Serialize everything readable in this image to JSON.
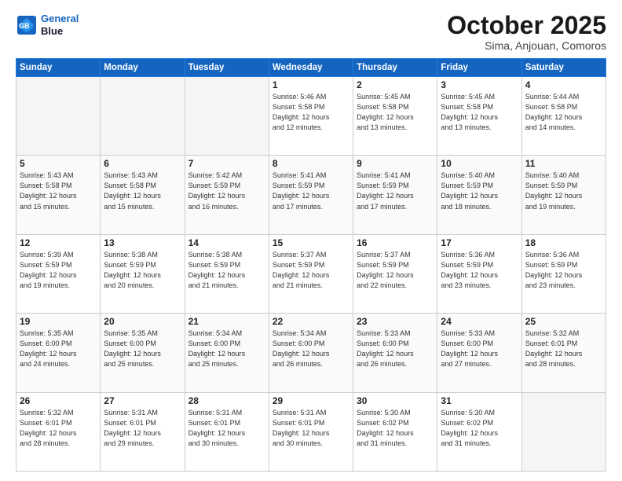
{
  "logo": {
    "line1": "General",
    "line2": "Blue"
  },
  "title": "October 2025",
  "location": "Sima, Anjouan, Comoros",
  "days_header": [
    "Sunday",
    "Monday",
    "Tuesday",
    "Wednesday",
    "Thursday",
    "Friday",
    "Saturday"
  ],
  "weeks": [
    [
      {
        "num": "",
        "info": ""
      },
      {
        "num": "",
        "info": ""
      },
      {
        "num": "",
        "info": ""
      },
      {
        "num": "1",
        "info": "Sunrise: 5:46 AM\nSunset: 5:58 PM\nDaylight: 12 hours\nand 12 minutes."
      },
      {
        "num": "2",
        "info": "Sunrise: 5:45 AM\nSunset: 5:58 PM\nDaylight: 12 hours\nand 13 minutes."
      },
      {
        "num": "3",
        "info": "Sunrise: 5:45 AM\nSunset: 5:58 PM\nDaylight: 12 hours\nand 13 minutes."
      },
      {
        "num": "4",
        "info": "Sunrise: 5:44 AM\nSunset: 5:58 PM\nDaylight: 12 hours\nand 14 minutes."
      }
    ],
    [
      {
        "num": "5",
        "info": "Sunrise: 5:43 AM\nSunset: 5:58 PM\nDaylight: 12 hours\nand 15 minutes."
      },
      {
        "num": "6",
        "info": "Sunrise: 5:43 AM\nSunset: 5:58 PM\nDaylight: 12 hours\nand 15 minutes."
      },
      {
        "num": "7",
        "info": "Sunrise: 5:42 AM\nSunset: 5:59 PM\nDaylight: 12 hours\nand 16 minutes."
      },
      {
        "num": "8",
        "info": "Sunrise: 5:41 AM\nSunset: 5:59 PM\nDaylight: 12 hours\nand 17 minutes."
      },
      {
        "num": "9",
        "info": "Sunrise: 5:41 AM\nSunset: 5:59 PM\nDaylight: 12 hours\nand 17 minutes."
      },
      {
        "num": "10",
        "info": "Sunrise: 5:40 AM\nSunset: 5:59 PM\nDaylight: 12 hours\nand 18 minutes."
      },
      {
        "num": "11",
        "info": "Sunrise: 5:40 AM\nSunset: 5:59 PM\nDaylight: 12 hours\nand 19 minutes."
      }
    ],
    [
      {
        "num": "12",
        "info": "Sunrise: 5:39 AM\nSunset: 5:59 PM\nDaylight: 12 hours\nand 19 minutes."
      },
      {
        "num": "13",
        "info": "Sunrise: 5:38 AM\nSunset: 5:59 PM\nDaylight: 12 hours\nand 20 minutes."
      },
      {
        "num": "14",
        "info": "Sunrise: 5:38 AM\nSunset: 5:59 PM\nDaylight: 12 hours\nand 21 minutes."
      },
      {
        "num": "15",
        "info": "Sunrise: 5:37 AM\nSunset: 5:59 PM\nDaylight: 12 hours\nand 21 minutes."
      },
      {
        "num": "16",
        "info": "Sunrise: 5:37 AM\nSunset: 5:59 PM\nDaylight: 12 hours\nand 22 minutes."
      },
      {
        "num": "17",
        "info": "Sunrise: 5:36 AM\nSunset: 5:59 PM\nDaylight: 12 hours\nand 23 minutes."
      },
      {
        "num": "18",
        "info": "Sunrise: 5:36 AM\nSunset: 5:59 PM\nDaylight: 12 hours\nand 23 minutes."
      }
    ],
    [
      {
        "num": "19",
        "info": "Sunrise: 5:35 AM\nSunset: 6:00 PM\nDaylight: 12 hours\nand 24 minutes."
      },
      {
        "num": "20",
        "info": "Sunrise: 5:35 AM\nSunset: 6:00 PM\nDaylight: 12 hours\nand 25 minutes."
      },
      {
        "num": "21",
        "info": "Sunrise: 5:34 AM\nSunset: 6:00 PM\nDaylight: 12 hours\nand 25 minutes."
      },
      {
        "num": "22",
        "info": "Sunrise: 5:34 AM\nSunset: 6:00 PM\nDaylight: 12 hours\nand 26 minutes."
      },
      {
        "num": "23",
        "info": "Sunrise: 5:33 AM\nSunset: 6:00 PM\nDaylight: 12 hours\nand 26 minutes."
      },
      {
        "num": "24",
        "info": "Sunrise: 5:33 AM\nSunset: 6:00 PM\nDaylight: 12 hours\nand 27 minutes."
      },
      {
        "num": "25",
        "info": "Sunrise: 5:32 AM\nSunset: 6:01 PM\nDaylight: 12 hours\nand 28 minutes."
      }
    ],
    [
      {
        "num": "26",
        "info": "Sunrise: 5:32 AM\nSunset: 6:01 PM\nDaylight: 12 hours\nand 28 minutes."
      },
      {
        "num": "27",
        "info": "Sunrise: 5:31 AM\nSunset: 6:01 PM\nDaylight: 12 hours\nand 29 minutes."
      },
      {
        "num": "28",
        "info": "Sunrise: 5:31 AM\nSunset: 6:01 PM\nDaylight: 12 hours\nand 30 minutes."
      },
      {
        "num": "29",
        "info": "Sunrise: 5:31 AM\nSunset: 6:01 PM\nDaylight: 12 hours\nand 30 minutes."
      },
      {
        "num": "30",
        "info": "Sunrise: 5:30 AM\nSunset: 6:02 PM\nDaylight: 12 hours\nand 31 minutes."
      },
      {
        "num": "31",
        "info": "Sunrise: 5:30 AM\nSunset: 6:02 PM\nDaylight: 12 hours\nand 31 minutes."
      },
      {
        "num": "",
        "info": ""
      }
    ]
  ]
}
